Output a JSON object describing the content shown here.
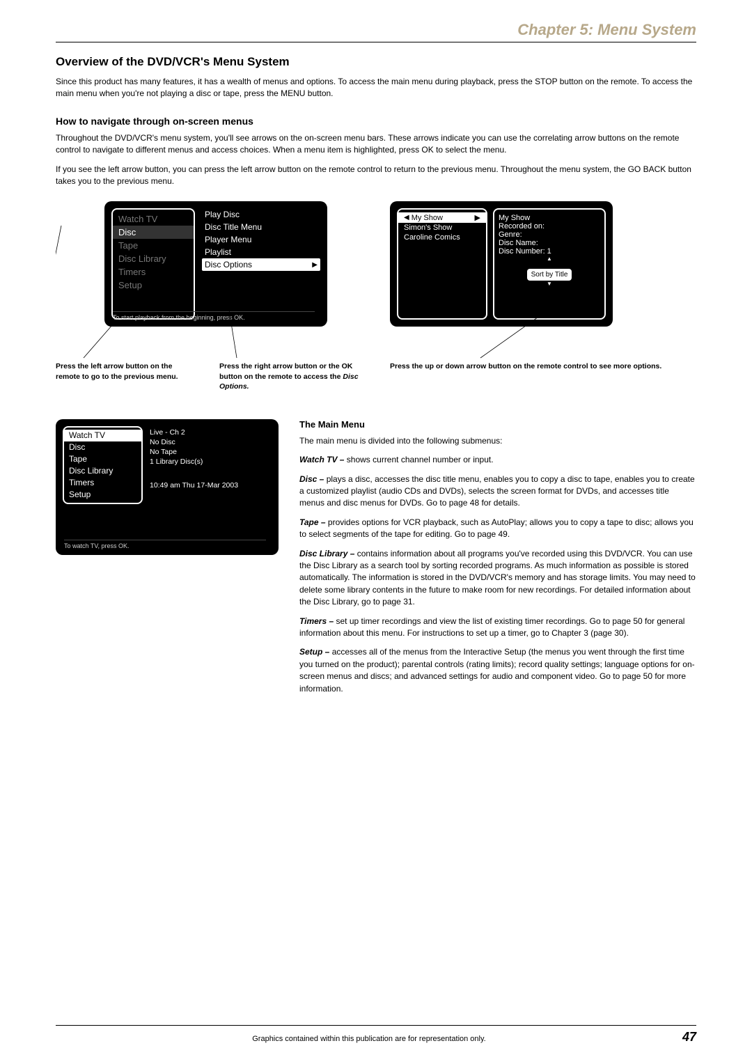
{
  "chapter_header": "Chapter 5: Menu System",
  "section_title": "Overview of the DVD/VCR's Menu System",
  "intro_p": "Since this product has many features, it has a wealth of menus and options. To access the main menu during playback, press the STOP button on the remote. To access the main menu when you're not playing a disc or tape, press the MENU button.",
  "nav_title": "How to navigate through on-screen menus",
  "nav_p1": "Throughout the DVD/VCR's menu system, you'll see arrows on the on-screen menu bars. These arrows indicate you can use the correlating arrow buttons on the remote control to navigate to different menus and access choices. When a menu item is highlighted, press OK to select the menu.",
  "nav_p2": "If you see the left arrow button, you can press the left arrow button on the remote control to return to the previous menu. Throughout the menu system, the GO BACK button takes you to the previous menu.",
  "osd1": {
    "left": [
      "Watch TV",
      "Disc",
      "Tape",
      "Disc Library",
      "Timers",
      "Setup"
    ],
    "right": [
      "Play Disc",
      "Disc Title Menu",
      "Player Menu",
      "Playlist",
      "Disc Options"
    ],
    "footer": "To start playback from the beginning, press OK."
  },
  "cap1": "Press the left arrow button on the remote to go to the previous menu.",
  "cap2a": "Press the right arrow button or the OK button on the remote to access the ",
  "cap2b": "Disc Options.",
  "osd3": {
    "left": [
      "My Show",
      "Simon's Show",
      "Caroline Comics"
    ],
    "rp_title": "My Show",
    "rp1": "Recorded on:",
    "rp2": "Genre:",
    "rp3": "Disc Name:",
    "rp4": "Disc Number: 1",
    "sort": "Sort by Title"
  },
  "cap3": "Press the up or down arrow button on the remote control to see more options.",
  "osd2": {
    "left": [
      "Watch TV",
      "Disc",
      "Tape",
      "Disc Library",
      "Timers",
      "Setup"
    ],
    "right": [
      "Live - Ch 2",
      "No Disc",
      "No Tape",
      "1 Library Disc(s)",
      "",
      "10:49 am Thu 17-Mar 2003"
    ],
    "footer": "To watch TV, press OK."
  },
  "mm_head": "The Main Menu",
  "mm_intro": "The main menu is divided into the following submenus:",
  "mm_items": [
    {
      "b": "Watch TV – ",
      "t": "shows current channel number or input."
    },
    {
      "b": "Disc – ",
      "t": "plays a disc, accesses the disc title menu, enables you to copy a disc to tape, enables you to create a customized playlist (audio CDs and DVDs), selects the screen format for DVDs, and accesses title menus and disc menus for DVDs. Go to page 48 for details."
    },
    {
      "b": "Tape – ",
      "t": "provides options for VCR playback, such as AutoPlay; allows you to copy a tape to disc; allows you to select segments of the tape for editing. Go to page 49."
    },
    {
      "b": "Disc Library – ",
      "t": "contains information about all programs you've recorded using this DVD/VCR. You can use the Disc Library as a search tool by sorting recorded programs. As much information as possible is stored automatically. The information is stored in the DVD/VCR's memory and has storage limits. You may need to delete some library contents in the future to make room for new recordings. For detailed information about the Disc Library, go to page 31."
    },
    {
      "b": "Timers – ",
      "t": "set up timer recordings and view the list of existing timer recordings. Go to page 50 for general information about this menu. For instructions to set up a timer, go to Chapter 3 (page 30)."
    },
    {
      "b": "Setup – ",
      "t": "accesses all of the menus from the Interactive Setup (the menus you went through the first time you turned on the product); parental controls (rating limits); record quality settings; language options for on-screen menus and discs; and advanced settings for audio and component video. Go to page 50 for more information."
    }
  ],
  "footer_text": "Graphics contained within this publication are for representation only.",
  "page_number": "47"
}
